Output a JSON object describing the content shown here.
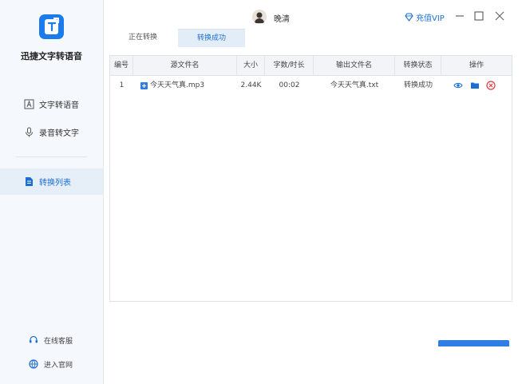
{
  "app": {
    "name": "迅捷文字转语音"
  },
  "sidebar": {
    "items": [
      {
        "label": "文字转语音",
        "icon": "text-icon"
      },
      {
        "label": "录音转文字",
        "icon": "microphone-icon"
      },
      {
        "label": "转换列表",
        "icon": "file-list-icon",
        "active": true
      }
    ],
    "footer": [
      {
        "label": "在线客服",
        "icon": "headset-icon"
      },
      {
        "label": "进入官网",
        "icon": "globe-icon"
      }
    ]
  },
  "titlebar": {
    "username": "晚清",
    "vip_label": "充值VIP",
    "controls": [
      "minimize-icon",
      "maximize-icon",
      "close-icon"
    ]
  },
  "tabs": [
    {
      "label": "正在转换",
      "active": false
    },
    {
      "label": "转换成功",
      "active": true
    }
  ],
  "table": {
    "columns": [
      "编号",
      "源文件名",
      "大小",
      "字数/时长",
      "输出文件名",
      "转换状态",
      "操作"
    ],
    "rows": [
      {
        "index": "1",
        "source": "今天天气真.mp3",
        "size": "2.44K",
        "duration": "00:02",
        "output": "今天天气真.txt",
        "status": "转换成功",
        "actions": [
          "eye-icon",
          "folder-icon",
          "delete-icon"
        ]
      }
    ]
  },
  "colors": {
    "accent": "#1c7bec",
    "active_bg": "#e6eef8",
    "delete": "#e0393e"
  }
}
